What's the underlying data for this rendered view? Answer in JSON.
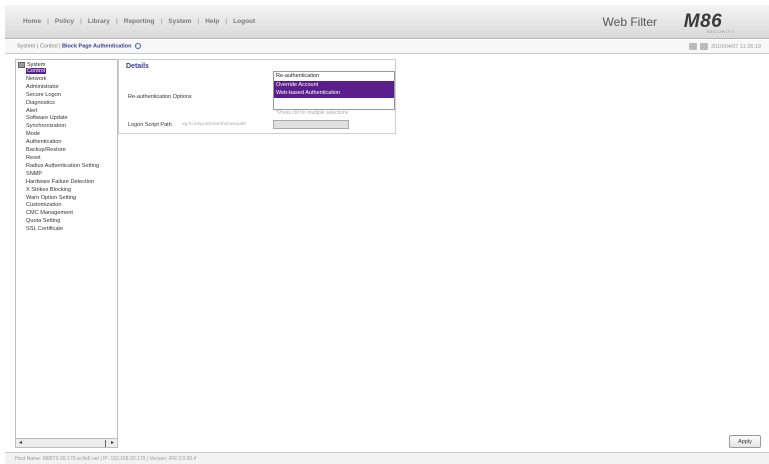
{
  "menu": {
    "items": [
      "Home",
      "Policy",
      "Library",
      "Reporting",
      "System",
      "Help",
      "Logout"
    ]
  },
  "brand": {
    "title": "Web Filter",
    "logo_text": "M86",
    "logo_sub": "SECURITY"
  },
  "breadcrumb": {
    "prefix": "System | Control | ",
    "current": "Block Page Authentication"
  },
  "topright": {
    "datetime": "2010/04/07 11:26:19"
  },
  "tree": {
    "root": "System",
    "items": [
      "Control",
      "Network",
      "Administrator",
      "Secure Logon",
      "Diagnostics",
      "Alert",
      "Software Update",
      "Synchronization",
      "Mode",
      "Authentication",
      "Backup/Restore",
      "Reset",
      "Radius Authentication Setting",
      "SNMP",
      "Hardware Failure Detection",
      "X Strikes Blocking",
      "Warn Option Setting",
      "Customization",
      "CMC Management",
      "Quota Setting",
      "SSL Certificate"
    ],
    "selected": "Control"
  },
  "details": {
    "title": "Details",
    "reauth_label": "Re-authentication Options",
    "options": [
      {
        "label": "Re-authentication",
        "selected": false
      },
      {
        "label": "Override Account",
        "selected": true
      },
      {
        "label": "Web-based Authentication",
        "selected": true
      }
    ],
    "multi_hint": "*Press ctrl for multiple selections",
    "script_label": "Logon Script Path",
    "script_hint": "eg:\\\\computername\\sharepath",
    "script_value": ""
  },
  "apply_label": "Apply",
  "status": "Host Name: M86T3-20-170.sr.8e6.net  |  IP: 192.168.20.170  |  Version: IFR 2.0.00.4",
  "colors": {
    "selection": "#5a1f8c",
    "title_blue": "#3a3a99"
  }
}
